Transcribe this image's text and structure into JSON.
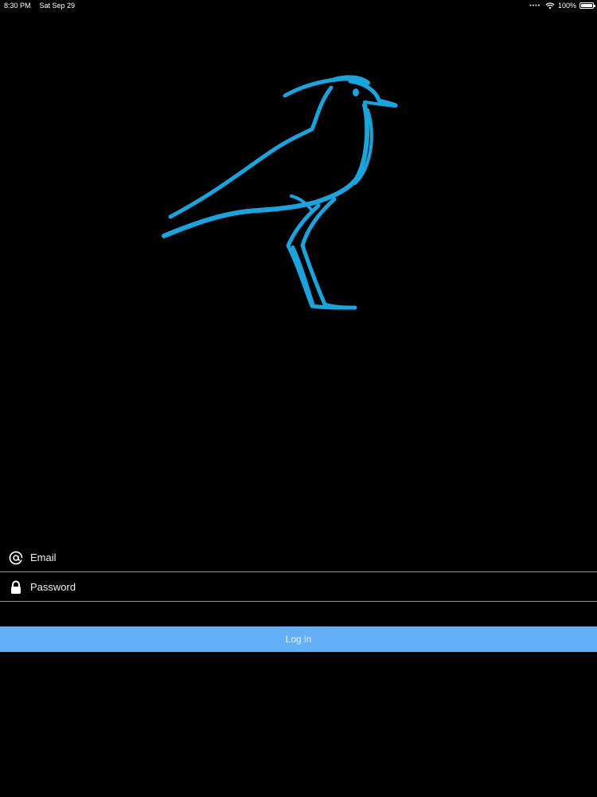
{
  "status_bar": {
    "time": "8:30 PM",
    "date": "Sat Sep 29",
    "battery": "100%",
    "icons": [
      "cellular-dots-icon",
      "wifi-icon",
      "battery-icon"
    ]
  },
  "logo": {
    "icon": "bird-logo-icon",
    "color": "#1ca3db"
  },
  "login_form": {
    "email": {
      "icon": "at-sign-icon",
      "placeholder": "Email",
      "value": ""
    },
    "password": {
      "icon": "lock-icon",
      "placeholder": "Password",
      "value": ""
    },
    "submit_label": "Log in"
  },
  "colors": {
    "background": "#000000",
    "button": "#64b0f6",
    "divider": "#9a9a9a",
    "accent": "#1ca3db"
  }
}
